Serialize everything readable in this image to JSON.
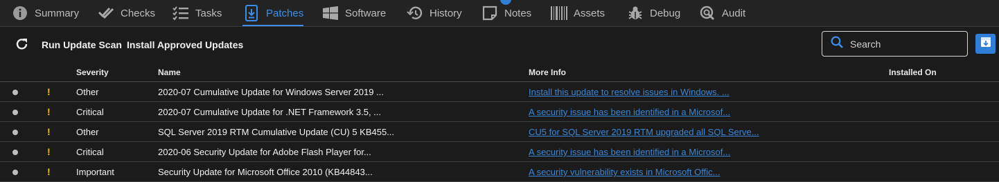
{
  "tabs": [
    {
      "label": "Summary",
      "icon": "info-icon"
    },
    {
      "label": "Checks",
      "icon": "double-check-icon"
    },
    {
      "label": "Tasks",
      "icon": "checklist-icon"
    },
    {
      "label": "Patches",
      "icon": "download-box-icon"
    },
    {
      "label": "Software",
      "icon": "windows-logo-icon"
    },
    {
      "label": "History",
      "icon": "history-icon"
    },
    {
      "label": "Notes",
      "icon": "note-icon"
    },
    {
      "label": "Assets",
      "icon": "barcode-icon"
    },
    {
      "label": "Debug",
      "icon": "bug-icon"
    },
    {
      "label": "Audit",
      "icon": "audit-search-icon"
    }
  ],
  "active_tab": "Patches",
  "colors": {
    "accent": "#3b8fe8",
    "warning": "#f2c200",
    "link": "#3a86d4"
  },
  "toolbar": {
    "refresh_icon": "refresh-icon",
    "run_scan_label": "Run Update Scan",
    "install_label": "Install Approved Updates",
    "search_placeholder": "Search",
    "export_icon": "export-icon"
  },
  "table": {
    "headers": {
      "severity": "Severity",
      "name": "Name",
      "more_info": "More Info",
      "installed_on": "Installed On"
    },
    "rows": [
      {
        "severity": "Other",
        "name": "2020-07 Cumulative Update for Windows Server 2019 ...",
        "more_info": "Install this update to resolve issues in Windows. ...",
        "installed_on": ""
      },
      {
        "severity": "Critical",
        "name": "2020-07 Cumulative Update for .NET Framework 3.5, ...",
        "more_info": "A security issue has been identified in a Microsof...",
        "installed_on": ""
      },
      {
        "severity": "Other",
        "name": "SQL Server 2019 RTM Cumulative Update (CU) 5 KB455...",
        "more_info": "CU5 for SQL Server 2019 RTM upgraded all SQL Serve...",
        "installed_on": ""
      },
      {
        "severity": "Critical",
        "name": "2020-06 Security Update for Adobe Flash Player for...",
        "more_info": "A security issue has been identified in a Microsof...",
        "installed_on": ""
      },
      {
        "severity": "Important",
        "name": "Security Update for Microsoft Office 2010 (KB44843...",
        "more_info": "A security vulnerability exists in Microsoft Offic...",
        "installed_on": ""
      }
    ],
    "warning_glyph": "!"
  }
}
